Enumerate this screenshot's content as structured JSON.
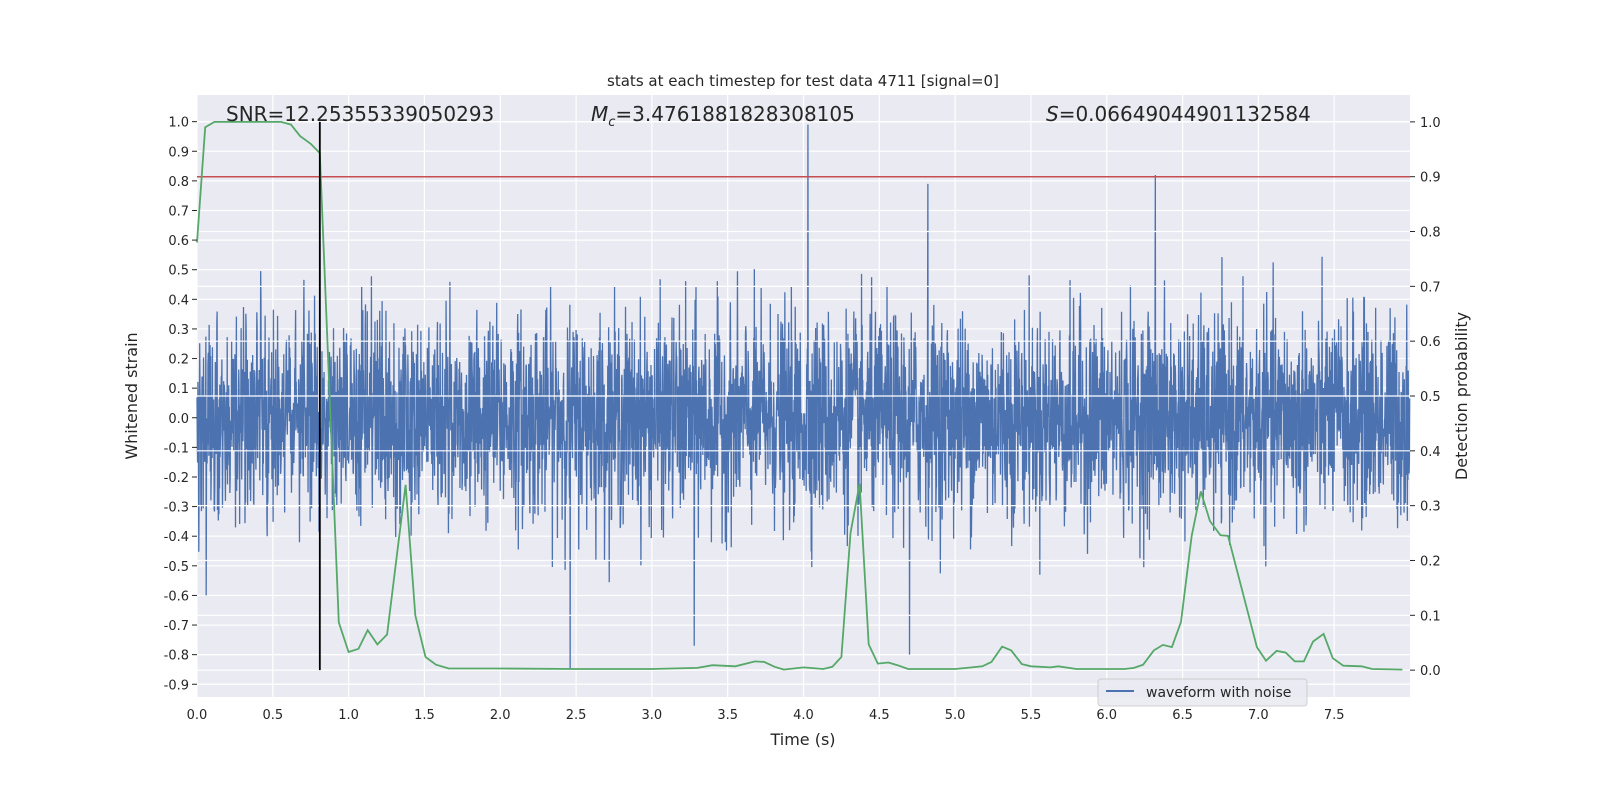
{
  "chart_data": {
    "type": "line",
    "title": "stats at each timestep for test data 4711 [signal=0]",
    "xlabel": "Time (s)",
    "ylabel_left": "Whitened strain",
    "ylabel_right": "Detection probability",
    "xlim": [
      0,
      8.0
    ],
    "ylim_left": [
      -0.943,
      1.09
    ],
    "ylim_right": [
      -0.049,
      1.049
    ],
    "x_ticks": [
      "0.0",
      "0.5",
      "1.0",
      "1.5",
      "2.0",
      "2.5",
      "3.0",
      "3.5",
      "4.0",
      "4.5",
      "5.0",
      "5.5",
      "6.0",
      "6.5",
      "7.0",
      "7.5"
    ],
    "y_ticks_left": [
      "1.0",
      "0.9",
      "0.8",
      "0.7",
      "0.6",
      "0.5",
      "0.4",
      "0.3",
      "0.2",
      "0.1",
      "0.0",
      "-0.1",
      "-0.2",
      "-0.3",
      "-0.4",
      "-0.5",
      "-0.6",
      "-0.7",
      "-0.8",
      "-0.9"
    ],
    "y_ticks_right": [
      "1.0",
      "0.9",
      "0.8",
      "0.7",
      "0.6",
      "0.5",
      "0.4",
      "0.3",
      "0.2",
      "0.1",
      "0.0"
    ],
    "grid": true,
    "background": "#eaeaf2",
    "legend": {
      "placement": "lower-right",
      "entries": [
        "waveform with noise"
      ]
    },
    "annotations": {
      "snr": "SNR=12.25355339050293",
      "mc_symbol": "M",
      "mc_sub": "c",
      "mc_value": "=3.4761881828308105",
      "s_symbol": "S",
      "s_value": "=0.06649044901132584"
    },
    "series": [
      {
        "name": "waveform with noise",
        "axis": "left",
        "color": "#4c72b0",
        "kind": "noise",
        "noise_envelope": 0.5,
        "notable_peaks": [
          [
            0.81,
            0.68
          ],
          [
            4.03,
            0.99
          ],
          [
            6.32,
            0.82
          ],
          [
            4.82,
            0.79
          ],
          [
            2.46,
            -0.85
          ],
          [
            4.7,
            -0.8
          ],
          [
            3.28,
            -0.77
          ],
          [
            0.06,
            -0.6
          ]
        ]
      },
      {
        "axis": "right",
        "color": "#55a868",
        "points": [
          [
            0,
            0.78
          ],
          [
            0.054,
            0.99
          ],
          [
            0.115,
            1.0
          ],
          [
            0.554,
            1.0
          ],
          [
            0.62,
            0.995
          ],
          [
            0.68,
            0.974
          ],
          [
            0.75,
            0.96
          ],
          [
            0.81,
            0.943
          ],
          [
            0.935,
            0.087
          ],
          [
            1.0,
            0.033
          ],
          [
            1.065,
            0.039
          ],
          [
            1.126,
            0.073
          ],
          [
            1.19,
            0.047
          ],
          [
            1.254,
            0.065
          ],
          [
            1.376,
            0.338
          ],
          [
            1.44,
            0.1
          ],
          [
            1.507,
            0.024
          ],
          [
            1.576,
            0.01
          ],
          [
            1.66,
            0.003
          ],
          [
            2.0,
            0.003
          ],
          [
            2.5,
            0.002
          ],
          [
            3.0,
            0.002
          ],
          [
            3.3,
            0.004
          ],
          [
            3.4,
            0.009
          ],
          [
            3.55,
            0.007
          ],
          [
            3.68,
            0.016
          ],
          [
            3.74,
            0.015
          ],
          [
            3.81,
            0.006
          ],
          [
            3.87,
            0.001
          ],
          [
            4.0,
            0.005
          ],
          [
            4.13,
            0.002
          ],
          [
            4.19,
            0.006
          ],
          [
            4.25,
            0.024
          ],
          [
            4.31,
            0.25
          ],
          [
            4.37,
            0.34
          ],
          [
            4.43,
            0.047
          ],
          [
            4.49,
            0.012
          ],
          [
            4.56,
            0.014
          ],
          [
            4.62,
            0.009
          ],
          [
            4.69,
            0.002
          ],
          [
            5.0,
            0.002
          ],
          [
            5.11,
            0.005
          ],
          [
            5.18,
            0.007
          ],
          [
            5.24,
            0.015
          ],
          [
            5.31,
            0.043
          ],
          [
            5.37,
            0.036
          ],
          [
            5.44,
            0.011
          ],
          [
            5.5,
            0.007
          ],
          [
            5.63,
            0.005
          ],
          [
            5.68,
            0.007
          ],
          [
            5.8,
            0.002
          ],
          [
            6.12,
            0.002
          ],
          [
            6.18,
            0.004
          ],
          [
            6.24,
            0.01
          ],
          [
            6.31,
            0.036
          ],
          [
            6.37,
            0.046
          ],
          [
            6.43,
            0.042
          ],
          [
            6.49,
            0.088
          ],
          [
            6.56,
            0.245
          ],
          [
            6.62,
            0.326
          ],
          [
            6.68,
            0.272
          ],
          [
            6.75,
            0.246
          ],
          [
            6.8,
            0.245
          ],
          [
            6.99,
            0.042
          ],
          [
            7.05,
            0.017
          ],
          [
            7.12,
            0.035
          ],
          [
            7.18,
            0.032
          ],
          [
            7.24,
            0.016
          ],
          [
            7.3,
            0.016
          ],
          [
            7.36,
            0.052
          ],
          [
            7.43,
            0.066
          ],
          [
            7.49,
            0.022
          ],
          [
            7.56,
            0.008
          ],
          [
            7.68,
            0.007
          ],
          [
            7.75,
            0.002
          ],
          [
            7.95,
            0.001
          ]
        ]
      }
    ],
    "threshold_line": {
      "axis": "right",
      "value": 0.9,
      "color": "#c44e52"
    },
    "marker_line": {
      "axis": "right",
      "time": 0.81,
      "from": 0.0,
      "to": 1.0,
      "color": "#000000"
    }
  }
}
